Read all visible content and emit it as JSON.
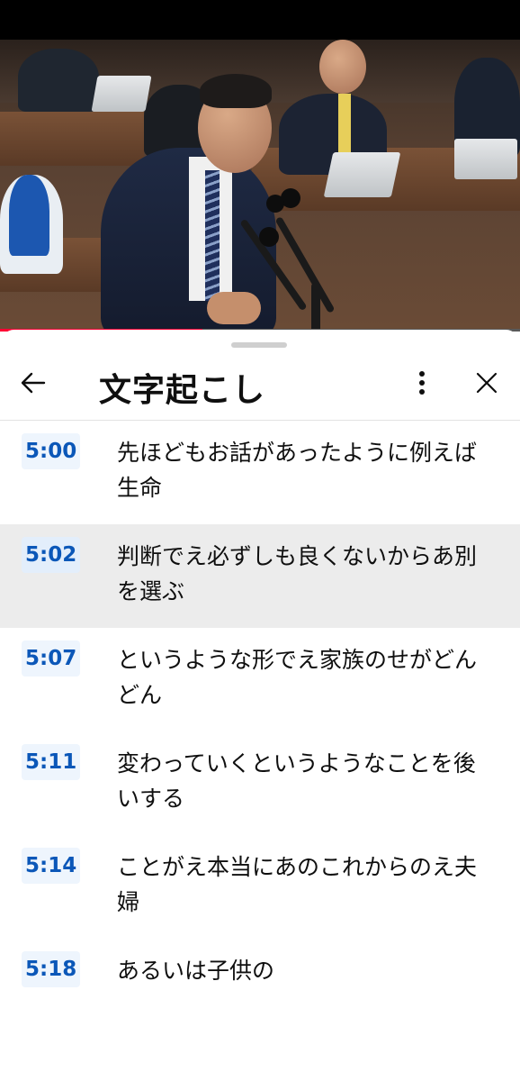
{
  "panel": {
    "title": "文字起こし",
    "back_icon": "arrow-left-icon",
    "more_icon": "more-vertical-icon",
    "close_icon": "close-icon"
  },
  "player": {
    "progress_fraction": 0.39
  },
  "colors": {
    "timestamp_text": "#0b57b8",
    "timestamp_bg": "#eef5fd",
    "active_row_bg": "#ececec",
    "progress": "#ff0033"
  },
  "segments": [
    {
      "time": "5:00",
      "text": "先ほどもお話があったように例えば生命"
    },
    {
      "time": "5:02",
      "text": "判断でえ必ずしも良くないからあ別を選ぶ"
    },
    {
      "time": "5:07",
      "text": "というような形でえ家族のせがどんどん"
    },
    {
      "time": "5:11",
      "text": "変わっていくというようなことを後いする"
    },
    {
      "time": "5:14",
      "text": "ことがえ本当にあのこれからのえ夫婦"
    },
    {
      "time": "5:18",
      "text": "あるいは子供の"
    }
  ]
}
